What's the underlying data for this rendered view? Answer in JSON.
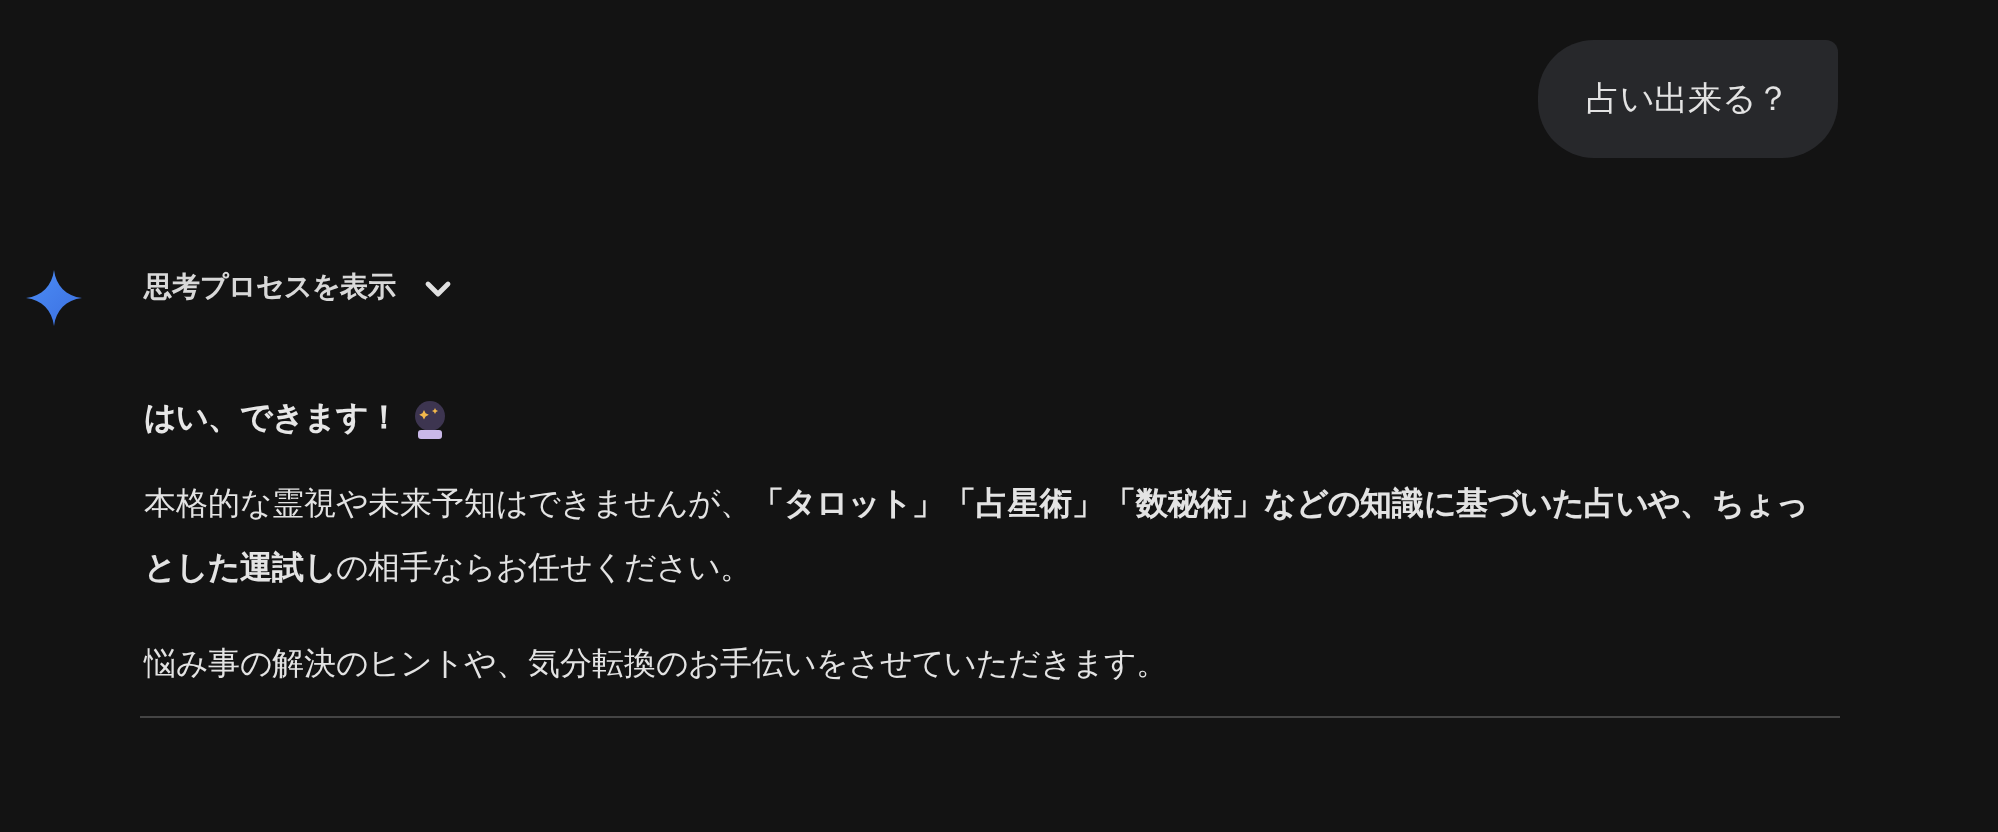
{
  "user_message": {
    "text": "占い出来る？"
  },
  "thinking_toggle": {
    "label": "思考プロセスを表示",
    "expanded": false
  },
  "response": {
    "heading": "はい、できます！",
    "paragraphs": [
      "本格的な霊視や未来予知はできませんが、**「タロット」「占星術」「数秘術」などの知識に基づいた占いや、ちょっとした運試し**の相手ならお任せください。",
      "悩み事の解決のヒントや、気分転換のお手伝いをさせていただきます。"
    ]
  }
}
